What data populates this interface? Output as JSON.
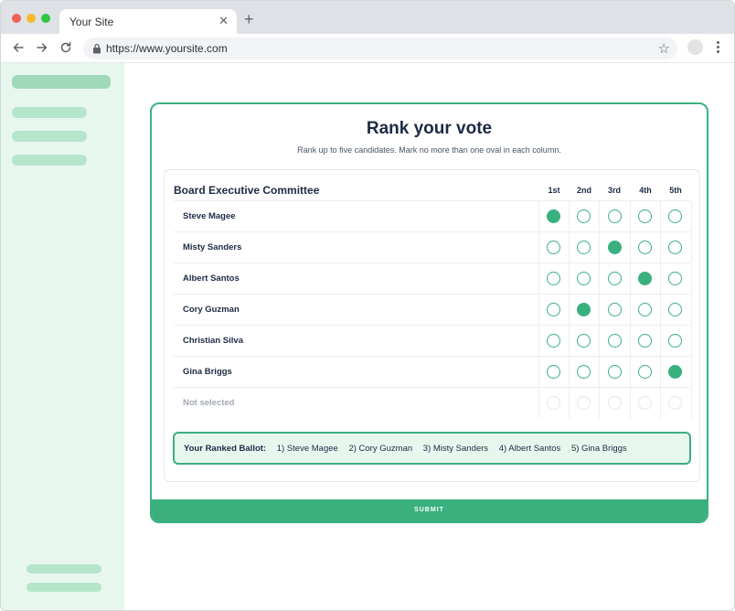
{
  "browser": {
    "tab_title": "Your Site",
    "tab_close": "✕",
    "new_tab": "+",
    "url": "https://www.yoursite.com",
    "star": "☆"
  },
  "ballot": {
    "title": "Rank your vote",
    "subtitle": "Rank up to five candidates. Mark no more than one oval in each column.",
    "committee": "Board Executive Committee",
    "columns": [
      "1st",
      "2nd",
      "3rd",
      "4th",
      "5th"
    ],
    "rows": [
      {
        "name": "Steve Magee",
        "selected": 1
      },
      {
        "name": "Misty Sanders",
        "selected": 3
      },
      {
        "name": "Albert Santos",
        "selected": 4
      },
      {
        "name": "Cory Guzman",
        "selected": 2
      },
      {
        "name": "Christian Silva",
        "selected": 0
      },
      {
        "name": "Gina Briggs",
        "selected": 5
      },
      {
        "name": "Not selected",
        "selected": 0,
        "muted": true
      }
    ],
    "summary_label": "Your Ranked Ballot:",
    "summary_items": [
      "1) Steve Magee",
      "2) Cory Guzman",
      "3) Misty Sanders",
      "4) Albert Santos",
      "5) Gina Briggs"
    ],
    "submit_label": "SUBMIT"
  },
  "colors": {
    "accent": "#3ab07e",
    "accent_light": "#e8f7ee",
    "sidebar_bar": "#b5e5cb",
    "text_dark": "#1d2a44"
  }
}
